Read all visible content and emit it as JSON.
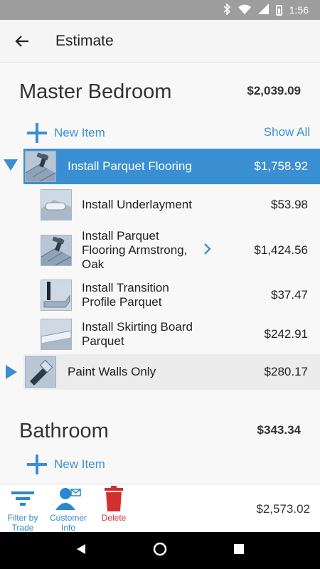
{
  "status": {
    "time": "1:56",
    "icons": [
      "bluetooth-icon",
      "wifi-icon",
      "signal-icon",
      "battery-icon"
    ]
  },
  "appbar": {
    "title": "Estimate"
  },
  "rooms": [
    {
      "name": "Master Bedroom",
      "total": "$2,039.09",
      "new_item_label": "New Item",
      "show_all_label": "Show All",
      "groups": [
        {
          "label": "Install Parquet Flooring",
          "price": "$1,758.92",
          "expanded": true,
          "children": [
            {
              "label": "Install Underlayment",
              "price": "$53.98"
            },
            {
              "label": "Install Parquet Flooring Armstrong, Oak",
              "price": "$1,424.56"
            },
            {
              "label": "Install Transition Profile Parquet",
              "price": "$37.47"
            },
            {
              "label": "Install Skirting Board Parquet",
              "price": "$242.91"
            }
          ]
        },
        {
          "label": "Paint Walls Only",
          "price": "$280.17",
          "expanded": false
        }
      ]
    },
    {
      "name": "Bathroom",
      "total": "$343.34",
      "new_item_label": "New Item"
    }
  ],
  "bottombar": {
    "filter_label": "Filter by Trade",
    "customer_label": "Customer Info",
    "delete_label": "Delete",
    "grand_total": "$2,573.02"
  },
  "colors": {
    "accent": "#3a8fd2",
    "delete": "#d32f2f",
    "selected_band": "#3a8fd2"
  }
}
